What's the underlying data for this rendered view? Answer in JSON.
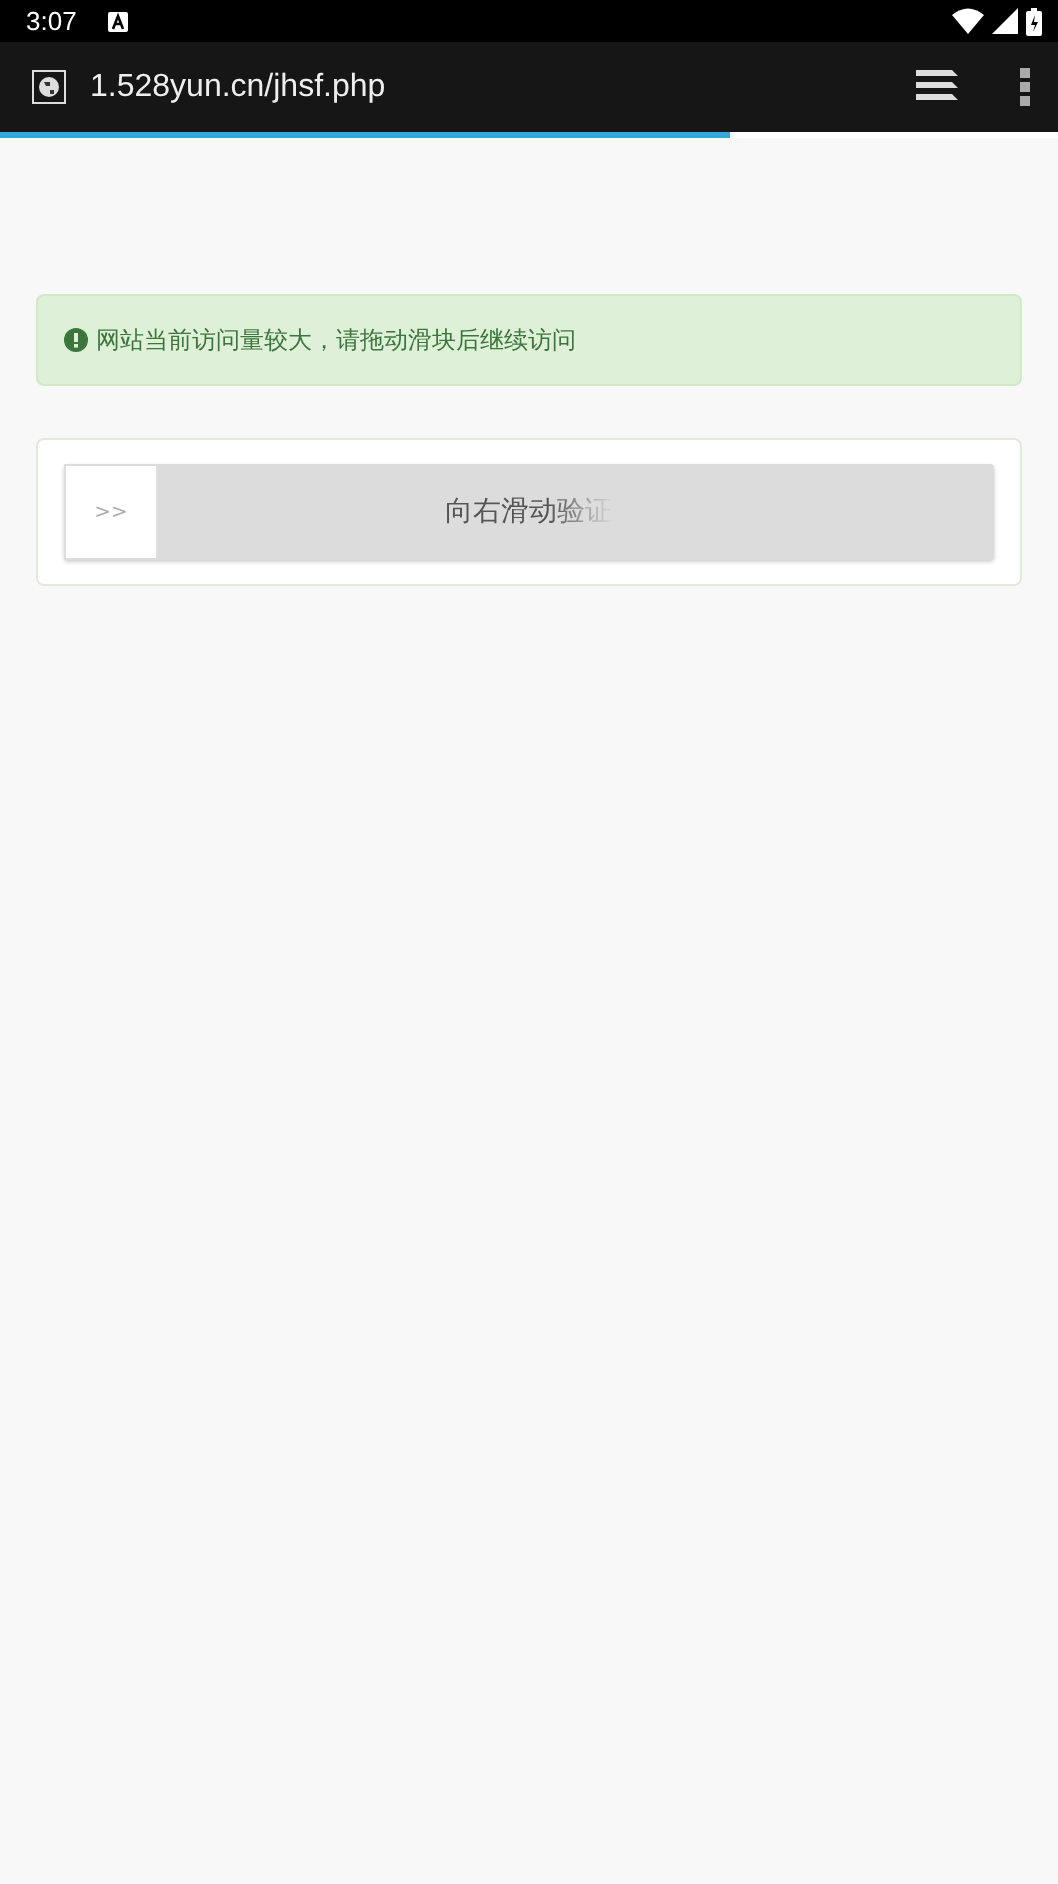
{
  "status_bar": {
    "time": "3:07"
  },
  "browser": {
    "url": "1.528yun.cn/jhsf.php",
    "load_progress": {
      "level": 0.69
    }
  },
  "alert": {
    "text": "网站当前访问量较大，请拖动滑块后继续访问"
  },
  "slider": {
    "handle": ">>",
    "label": "向右滑动验证",
    "level": 0
  }
}
